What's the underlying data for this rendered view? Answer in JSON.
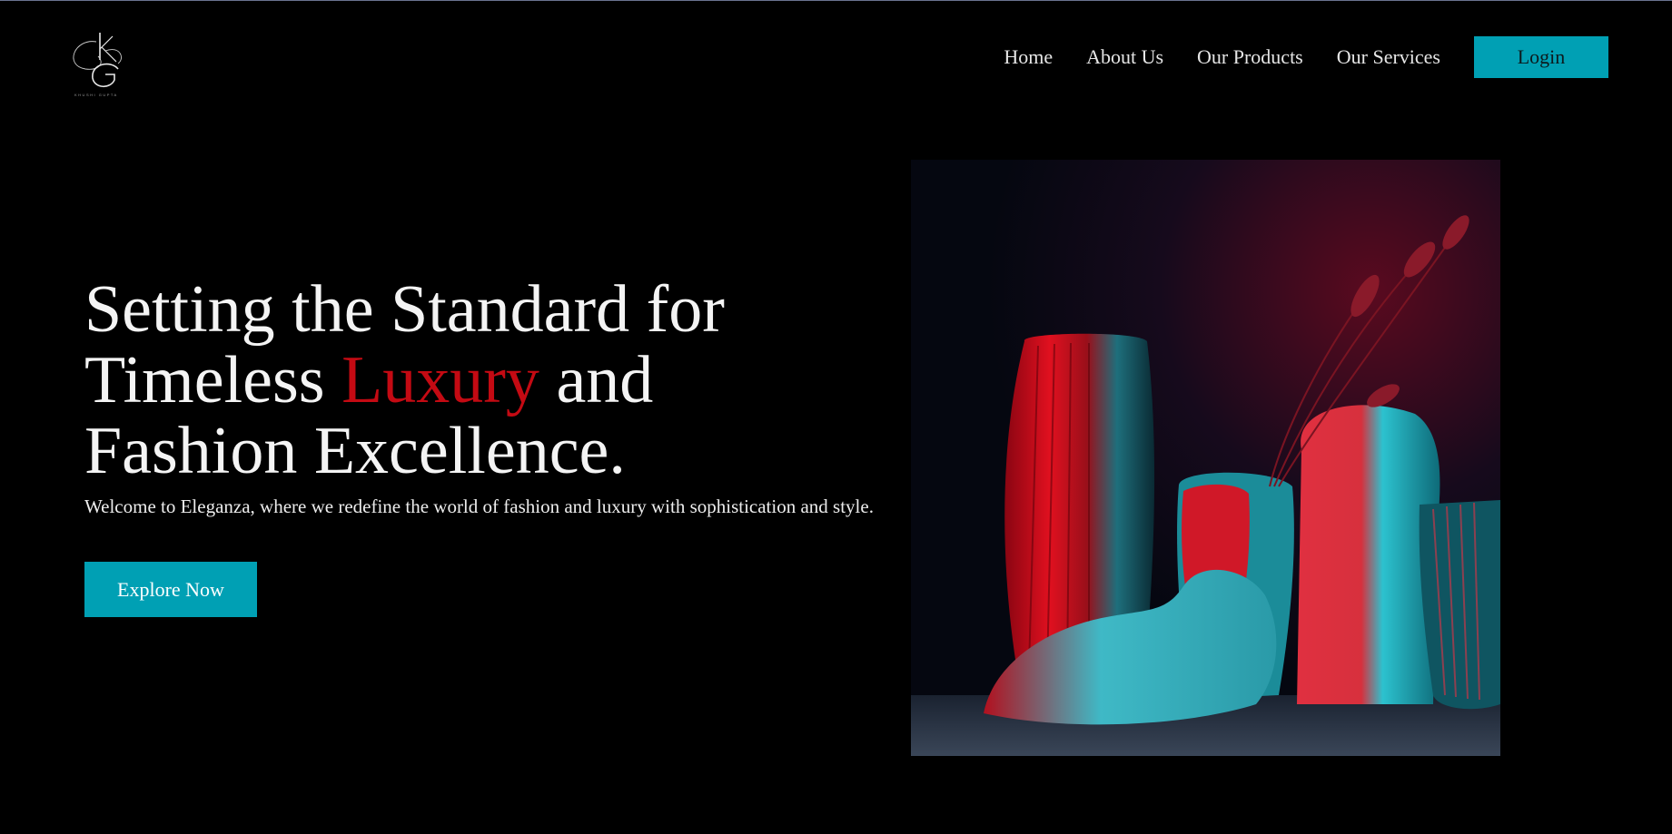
{
  "brand": {
    "logo_name": "monogram-logo",
    "caption": "KHUSHI GUPTA"
  },
  "nav": {
    "items": [
      {
        "label": "Home"
      },
      {
        "label": "About Us"
      },
      {
        "label": "Our Products"
      },
      {
        "label": "Our Services"
      }
    ],
    "login_label": "Login"
  },
  "hero": {
    "title_line1": "Setting the Standard for",
    "title_line2_pre": "Timeless ",
    "title_accent": "Luxury",
    "title_line2_post": " and",
    "title_line3": "Fashion Excellence.",
    "subtitle": "Welcome to Eleganza, where we redefine the world of fashion and luxury with sophistication and style.",
    "cta_label": "Explore Now"
  },
  "colors": {
    "background": "#000000",
    "accent_teal": "#00a0b4",
    "accent_red": "#c40a13",
    "text": "#f2f2f2"
  },
  "icons": {
    "logo": "kg-monogram-icon",
    "hero_image": "vases-still-life-image"
  }
}
